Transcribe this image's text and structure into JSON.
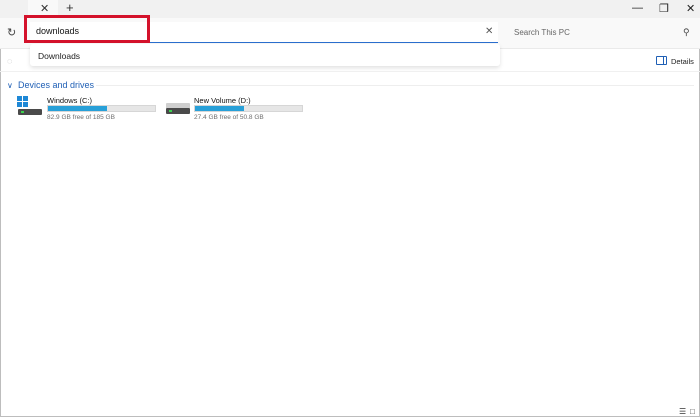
{
  "titlebar": {
    "tab_close": "✕",
    "new_tab": "+",
    "minimize": "—",
    "restore": "❐",
    "close": "✕"
  },
  "toolbar": {
    "refresh": "↻",
    "address_value": "downloads",
    "address_clear": "✕",
    "search_placeholder": "Search This PC",
    "search_icon": "⚲"
  },
  "suggestions": [
    "Downloads"
  ],
  "commandbar": {
    "details_label": "Details"
  },
  "group": {
    "chevron": "∨",
    "title": "Devices and drives"
  },
  "drives": [
    {
      "name": "Windows (C:)",
      "free_text": "82.9 GB free of 185 GB",
      "used_fraction": 0.552,
      "icon": "windows-drive-icon"
    },
    {
      "name": "New Volume (D:)",
      "free_text": "27.4 GB free of 50.8 GB",
      "used_fraction": 0.46,
      "icon": "hard-drive-icon"
    }
  ],
  "statusbar": {
    "list_view": "☰",
    "tiles_view": "□"
  },
  "colors": {
    "accent": "#1f5fb5",
    "drive_bar": "#28a0d8",
    "highlight_box": "#d4122b"
  }
}
